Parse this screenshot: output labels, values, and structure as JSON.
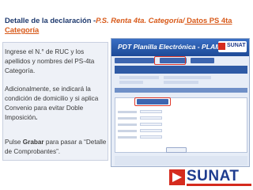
{
  "slide": {
    "title_prefix": "Detalle de la declaración -",
    "title_italic": "P.S. Renta 4ta. Categoría/",
    "title_underlined": " Datos PS 4ta Categoría ",
    "para1": "Ingrese el N.° de RUC y los apellidos y nombres del PS-4ta Categoría.",
    "para2_text": "Adicionalmente, se indicará la condición de domicilio y si aplica Convenio para evitar Doble Imposición",
    "para2_end": ".",
    "para3_pre": "Pulse ",
    "para3_bold": "Grabar",
    "para3_post": " para pasar a “Detalle de Comprobantes”."
  },
  "screenshot": {
    "app_title": "PDT  Planilla Electrónica - PLAME",
    "brand_small": "SUNAT"
  },
  "logo": {
    "text": "SUNAT"
  }
}
